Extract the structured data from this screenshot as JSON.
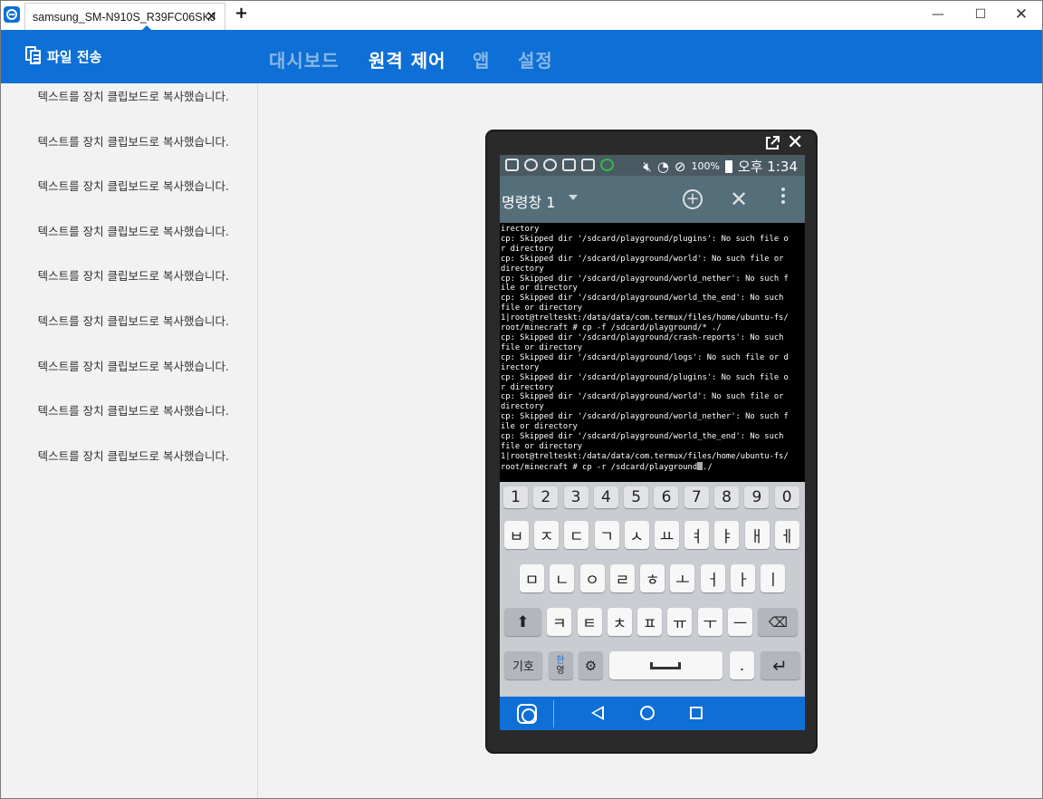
{
  "window": {
    "tab_title": "samsung_SM-N910S_R39FC06SKJ",
    "tab_close": "✕",
    "new_tab": "+",
    "minimize": "—",
    "maximize": "☐",
    "close": "✕"
  },
  "header": {
    "file_transfer": "파일 전송",
    "nav": {
      "dashboard": "대시보드",
      "remote_control": "원격 제어",
      "apps": "앱",
      "settings": "설정"
    }
  },
  "log": {
    "items": [
      "텍스트를 장치 클립보드로 복사했습니다.",
      "텍스트를 장치 클립보드로 복사했습니다.",
      "텍스트를 장치 클립보드로 복사했습니다.",
      "텍스트를 장치 클립보드로 복사했습니다.",
      "텍스트를 장치 클립보드로 복사했습니다.",
      "텍스트를 장치 클립보드로 복사했습니다.",
      "텍스트를 장치 클립보드로 복사했습니다.",
      "텍스트를 장치 클립보드로 복사했습니다.",
      "텍스트를 장치 클립보드로 복사했습니다."
    ]
  },
  "phone": {
    "status": {
      "battery": "100%",
      "time": "오후 1:34"
    },
    "terminal_title": "명령창 1",
    "terminal_lines": [
      "irectory",
      "cp: Skipped dir '/sdcard/playground/plugins': No such file o",
      "r directory",
      "cp: Skipped dir '/sdcard/playground/world': No such file or",
      "directory",
      "cp: Skipped dir '/sdcard/playground/world_nether': No such f",
      "ile or directory",
      "cp: Skipped dir '/sdcard/playground/world_the_end': No such",
      "file or directory",
      "1|root@trelteskt:/data/data/com.termux/files/home/ubuntu-fs/",
      "root/minecraft # cp -f /sdcard/playground/* ./",
      "cp: Skipped dir '/sdcard/playground/crash-reports': No such",
      "file or directory",
      "cp: Skipped dir '/sdcard/playground/logs': No such file or d",
      "irectory",
      "cp: Skipped dir '/sdcard/playground/plugins': No such file o",
      "r directory",
      "cp: Skipped dir '/sdcard/playground/world': No such file or",
      "directory",
      "cp: Skipped dir '/sdcard/playground/world_nether': No such f",
      "ile or directory",
      "cp: Skipped dir '/sdcard/playground/world_the_end': No such",
      "file or directory",
      "1|root@trelteskt:/data/data/com.termux/files/home/ubuntu-fs/"
    ],
    "prompt_before_cursor": "root/minecraft # cp -r /sdcard/playground",
    "prompt_after_cursor": "./",
    "keyboard": {
      "numbers": [
        "1",
        "2",
        "3",
        "4",
        "5",
        "6",
        "7",
        "8",
        "9",
        "0"
      ],
      "row1": [
        "ㅂ",
        "ㅈ",
        "ㄷ",
        "ㄱ",
        "ㅅ",
        "ㅛ",
        "ㅕ",
        "ㅑ",
        "ㅐ",
        "ㅔ"
      ],
      "row2": [
        "ㅁ",
        "ㄴ",
        "ㅇ",
        "ㄹ",
        "ㅎ",
        "ㅗ",
        "ㅓ",
        "ㅏ",
        "ㅣ"
      ],
      "row3": [
        "ㅋ",
        "ㅌ",
        "ㅊ",
        "ㅍ",
        "ㅠ",
        "ㅜ",
        "ㅡ"
      ],
      "shift": "⬆",
      "backspace": "⌫",
      "symbols": "기호",
      "lang_top": "한",
      "lang_bottom": "영",
      "settings": "⚙",
      "period": ".",
      "enter": "↵"
    }
  }
}
